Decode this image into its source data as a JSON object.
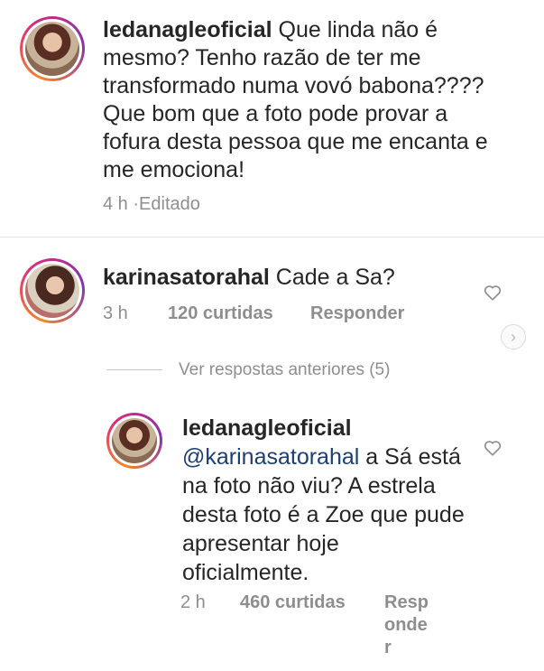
{
  "comments": [
    {
      "username": "ledanagleoficial",
      "text": " Que linda não é mesmo? Tenho razão de ter me transformado  numa vovó babona???? Que bom que a foto pode provar a fofura desta pessoa que me encanta e me emociona!",
      "lines": [
        " Que linda não é",
        "mesmo? Tenho razão de ter me",
        "transformado  numa vovó babona????",
        "Que bom que a foto pode provar a",
        "fofura desta pessoa que me encanta e",
        "me emociona!"
      ],
      "time": "4 h",
      "separator": "·",
      "edited": "Editado"
    },
    {
      "username": "karinasatorahal",
      "text": " Cade a Sa?",
      "time": "3 h",
      "likes": "120 curtidas",
      "reply": "Responder"
    }
  ],
  "view_replies": "Ver respostas anteriores (5)",
  "reply": {
    "username": "ledanagleoficial",
    "mention": "@karinasatorahal",
    "lines": [
      " a Sá está",
      "na foto não viu? A estrela",
      "desta foto é a Zoe que pude",
      "apresentar hoje",
      "oficialmente."
    ],
    "time": "2 h",
    "likes": "460 curtidas",
    "reply_lines": [
      "Resp",
      "onde",
      "r"
    ]
  },
  "icons": {
    "heart": "heart-outline-icon",
    "chevron": "chevron-right-icon"
  },
  "colors": {
    "text": "#262626",
    "meta": "#8e8e8e",
    "mention": "#1b3f74"
  }
}
